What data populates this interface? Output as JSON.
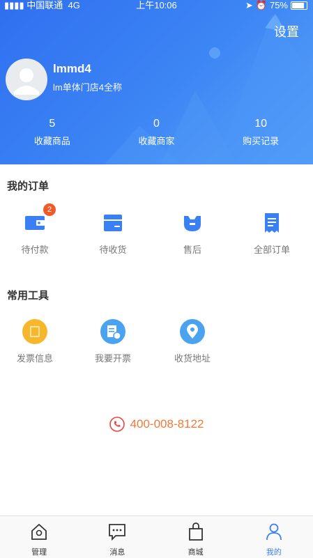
{
  "status_bar": {
    "carrier": "中国联通",
    "network": "4G",
    "time": "上午10:06",
    "battery": "75%"
  },
  "header": {
    "settings": "设置",
    "username": "lmmd4",
    "shop_name": "lm单体门店4全称",
    "stats": [
      {
        "value": "5",
        "label": "收藏商品"
      },
      {
        "value": "0",
        "label": "收藏商家"
      },
      {
        "value": "10",
        "label": "购买记录"
      }
    ]
  },
  "orders": {
    "title": "我的订单",
    "items": [
      {
        "label": "待付款",
        "icon": "wallet-icon",
        "badge": "2"
      },
      {
        "label": "待收货",
        "icon": "package-icon"
      },
      {
        "label": "售后",
        "icon": "wrench-icon"
      },
      {
        "label": "全部订单",
        "icon": "receipt-icon"
      }
    ]
  },
  "tools": {
    "title": "常用工具",
    "items": [
      {
        "label": "发票信息",
        "icon": "invoice-icon"
      },
      {
        "label": "我要开票",
        "icon": "issue-invoice-icon"
      },
      {
        "label": "收货地址",
        "icon": "location-icon"
      }
    ]
  },
  "hotline": "400-008-8122",
  "tabbar": [
    {
      "label": "管理",
      "icon": "home-icon"
    },
    {
      "label": "消息",
      "icon": "message-icon"
    },
    {
      "label": "商城",
      "icon": "bag-icon"
    },
    {
      "label": "我的",
      "icon": "person-icon",
      "active": true
    }
  ],
  "colors": {
    "primary": "#3a80f5",
    "badge": "#f05a28",
    "hotline": "#f07a3a",
    "tool_yellow": "#f6b72c",
    "tool_blue": "#4aa3f0"
  }
}
